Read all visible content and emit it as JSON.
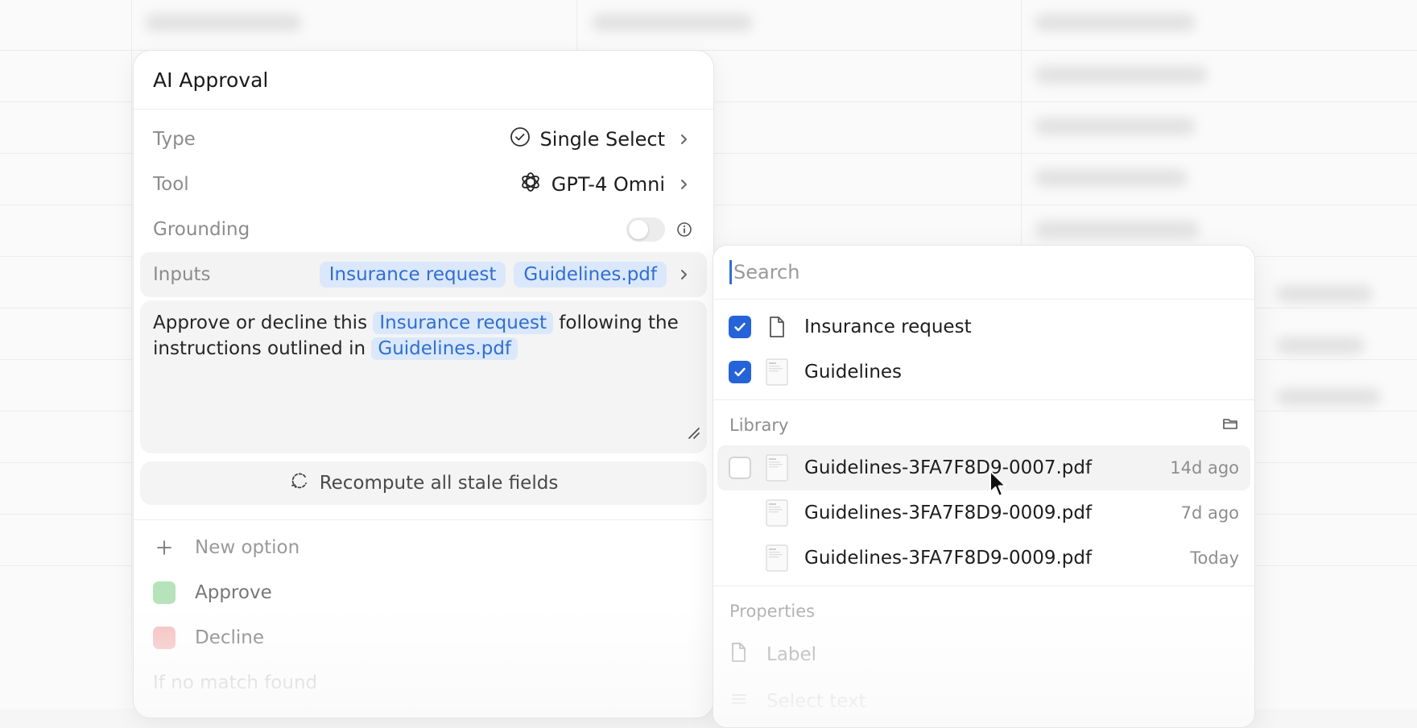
{
  "panel": {
    "title": "AI Approval",
    "type_label": "Type",
    "type_value": "Single Select",
    "tool_label": "Tool",
    "tool_value": "GPT-4 Omni",
    "grounding_label": "Grounding",
    "grounding_enabled": false,
    "inputs_label": "Inputs",
    "inputs": [
      "Insurance request",
      "Guidelines.pdf"
    ],
    "prompt": {
      "part1": "Approve or decline this",
      "chip1": "Insurance request",
      "part2": "following the instructions outlined in",
      "chip2": "Guidelines.pdf"
    },
    "recompute_label": "Recompute all stale fields",
    "new_option_label": "New option",
    "options": [
      {
        "label": "Approve",
        "color": "#b6e3b9"
      },
      {
        "label": "Decline",
        "color": "#f6bcbc"
      }
    ],
    "no_match_label": "If no match found"
  },
  "dropdown": {
    "search_placeholder": "Search",
    "selected": [
      {
        "name": "Insurance request",
        "checked": true,
        "icon": "document-icon"
      },
      {
        "name": "Guidelines",
        "checked": true,
        "icon": "pdf-thumbnail-icon"
      }
    ],
    "library_label": "Library",
    "library": [
      {
        "name": "Guidelines-3FA7F8D9-0007.pdf",
        "time": "14d ago"
      },
      {
        "name": "Guidelines-3FA7F8D9-0009.pdf",
        "time": "7d ago"
      },
      {
        "name": "Guidelines-3FA7F8D9-0009.pdf",
        "time": "Today"
      }
    ],
    "properties_label": "Properties",
    "properties": [
      {
        "name": "Label",
        "icon": "document-icon"
      },
      {
        "name": "Select text",
        "icon": "list-icon"
      }
    ]
  },
  "colors": {
    "accent": "#2563d9",
    "chip_bg": "#dbe8fb",
    "chip_text": "#2f6fd2"
  }
}
